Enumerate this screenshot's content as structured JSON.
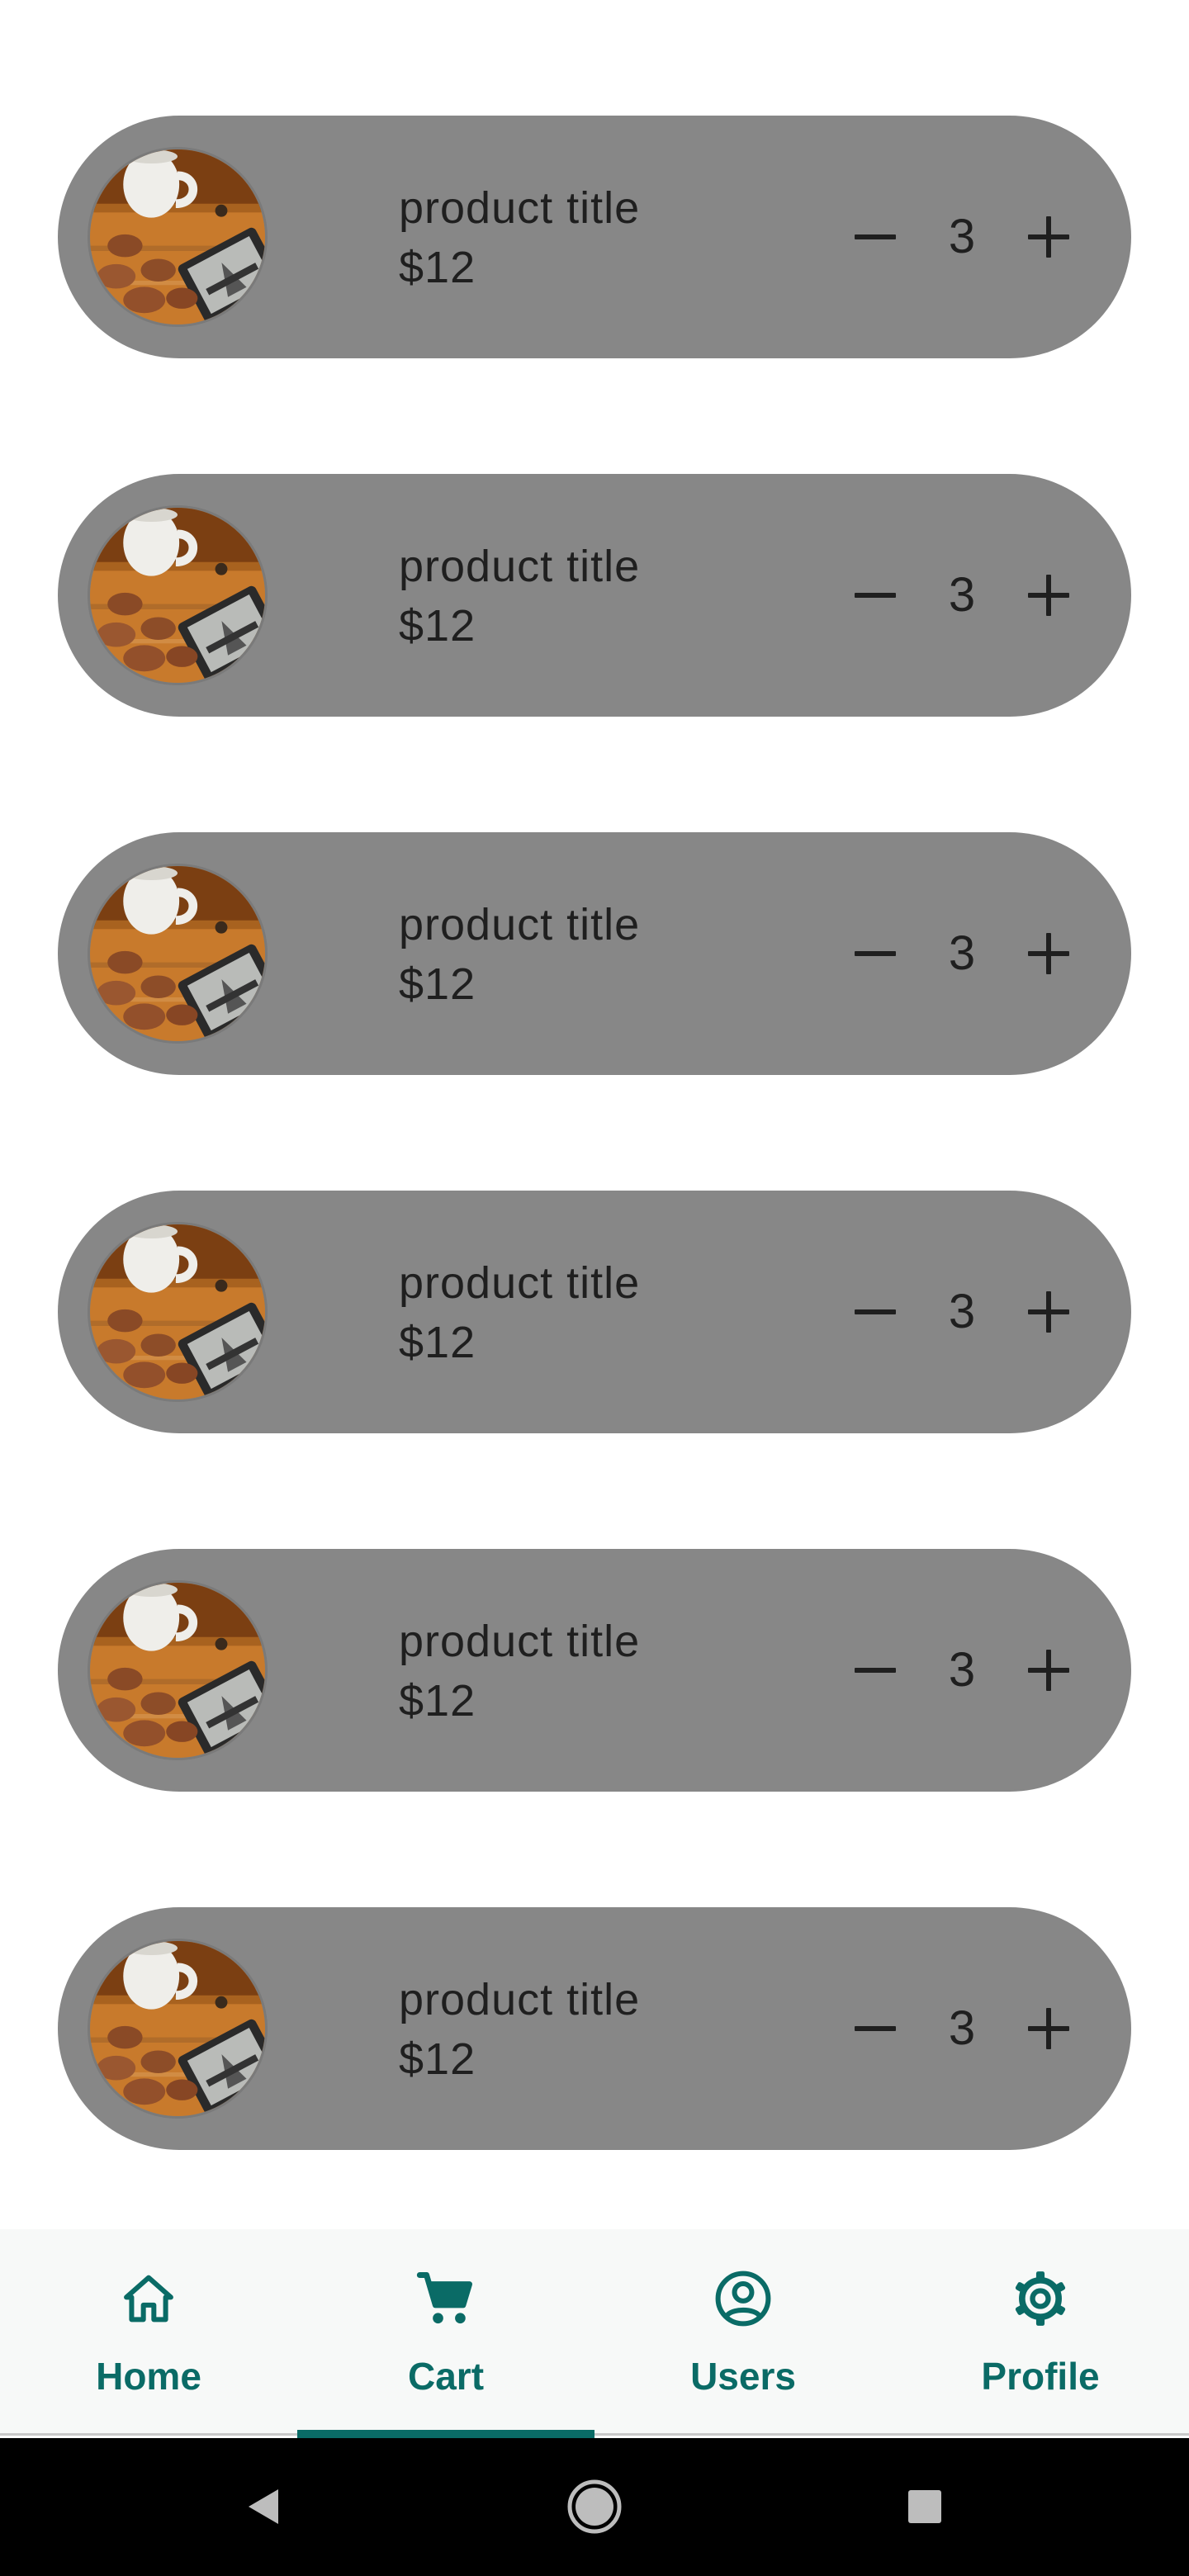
{
  "theme": {
    "accent": "#0a6b66",
    "card_bg": "#878787",
    "text": "#1f1f1f",
    "nav_bg": "#f7f9f8"
  },
  "cart": {
    "items": [
      {
        "title": "product title",
        "price": "$12",
        "quantity": "3",
        "image": "coffee-cookies-ereader-photo"
      },
      {
        "title": "product title",
        "price": "$12",
        "quantity": "3",
        "image": "coffee-cookies-ereader-photo"
      },
      {
        "title": "product title",
        "price": "$12",
        "quantity": "3",
        "image": "coffee-cookies-ereader-photo"
      },
      {
        "title": "product title",
        "price": "$12",
        "quantity": "3",
        "image": "coffee-cookies-ereader-photo"
      },
      {
        "title": "product title",
        "price": "$12",
        "quantity": "3",
        "image": "coffee-cookies-ereader-photo"
      },
      {
        "title": "product title",
        "price": "$12",
        "quantity": "3",
        "image": "coffee-cookies-ereader-photo"
      }
    ],
    "decrement_icon": "minus-icon",
    "increment_icon": "plus-icon"
  },
  "bottom_nav": {
    "active": "Cart",
    "items": [
      {
        "label": "Home",
        "icon": "home-icon"
      },
      {
        "label": "Cart",
        "icon": "cart-icon"
      },
      {
        "label": "Users",
        "icon": "account-circle-icon"
      },
      {
        "label": "Profile",
        "icon": "gear-icon"
      }
    ]
  },
  "system_nav": {
    "buttons": [
      "back-icon",
      "home-circle-icon",
      "recents-square-icon"
    ]
  }
}
